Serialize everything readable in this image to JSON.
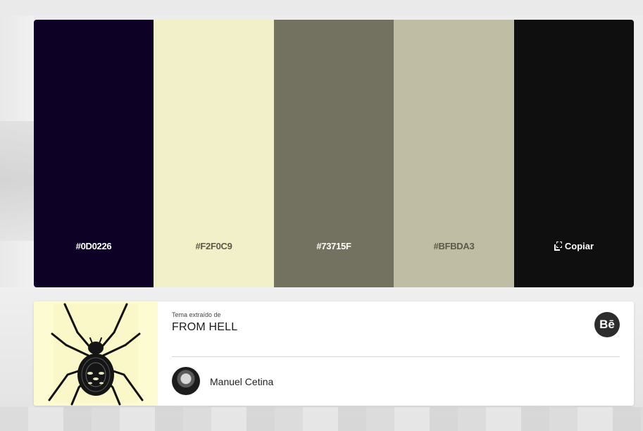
{
  "palette": {
    "swatches": [
      {
        "hex": "#0D0226",
        "color": "#0D0226",
        "text_color": "#ffffff"
      },
      {
        "hex": "#F2F0C9",
        "color": "#F2F0C9",
        "text_color": "#5a5a48"
      },
      {
        "hex": "#73715F",
        "color": "#73715F",
        "text_color": "#ffffff"
      },
      {
        "hex": "#BFBDA3",
        "color": "#BFBDA3",
        "text_color": "#5a5a48"
      }
    ],
    "copy_swatch": {
      "color": "#0F0F0F",
      "label": "Copiar",
      "icon": "copy-icon"
    }
  },
  "card": {
    "extracted_label": "Tema extraído de",
    "title": "FROM HELL",
    "behance_label": "Bē",
    "author": "Manuel Cetina",
    "thumbnail": "spider-illustration"
  }
}
